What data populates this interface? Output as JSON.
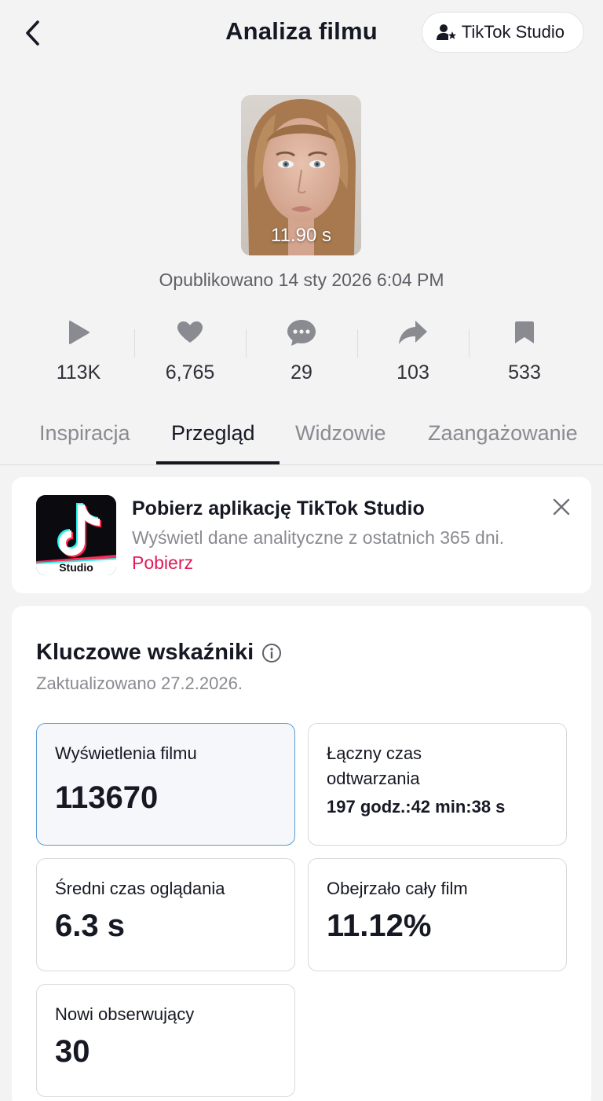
{
  "header": {
    "title": "Analiza filmu",
    "studio_button": "TikTok Studio"
  },
  "video": {
    "duration": "11.90 s",
    "published": "Opublikowano 14 sty 2026 6:04 PM"
  },
  "stats": [
    {
      "icon": "play-icon",
      "value": "113K"
    },
    {
      "icon": "heart-icon",
      "value": "6,765"
    },
    {
      "icon": "comment-icon",
      "value": "29"
    },
    {
      "icon": "share-icon",
      "value": "103"
    },
    {
      "icon": "bookmark-icon",
      "value": "533"
    }
  ],
  "tabs": [
    {
      "label": "Inspiracja",
      "active": false
    },
    {
      "label": "Przegląd",
      "active": true
    },
    {
      "label": "Widzowie",
      "active": false
    },
    {
      "label": "Zaangażowanie",
      "active": false
    }
  ],
  "banner": {
    "title": "Pobierz aplikację TikTok Studio",
    "description": "Wyświetl dane analityczne z ostatnich 365 dni.",
    "link": "Pobierz",
    "logo_caption": "Studio"
  },
  "metrics": {
    "title": "Kluczowe wskaźniki",
    "updated": "Zaktualizowano 27.2.2026.",
    "tiles": [
      {
        "label": "Wyświetlenia filmu",
        "value": "113670"
      },
      {
        "label": "Łączny czas odtwarzania",
        "value": "197 godz.:42 min:38 s"
      },
      {
        "label": "Średni czas oglądania",
        "value": "6.3 s"
      },
      {
        "label": "Obejrzało cały film",
        "value": "11.12%"
      },
      {
        "label": "Nowi obserwujący",
        "value": "30"
      }
    ]
  },
  "colors": {
    "accent_pink": "#e01b5a",
    "selected_border": "#5b9bd5",
    "background": "#f3f3f3"
  }
}
